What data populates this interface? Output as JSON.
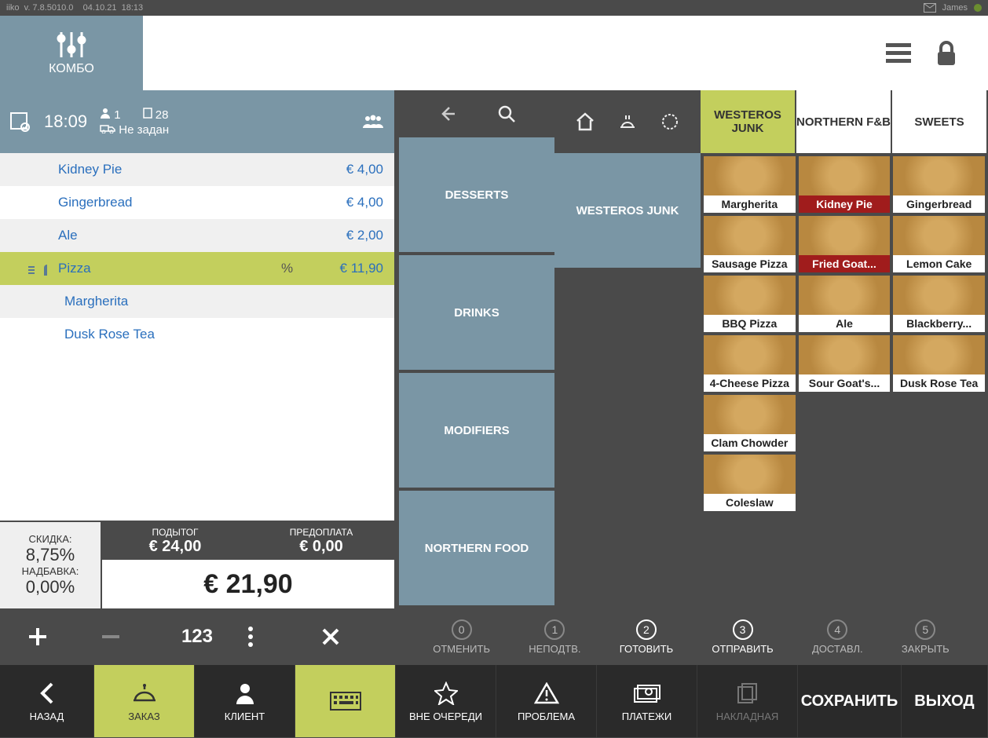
{
  "topbar": {
    "app": "iiko",
    "version": "v. 7.8.5010.0",
    "date": "04.10.21",
    "time": "18:13",
    "user": "James"
  },
  "combo": {
    "label": "КОМБО"
  },
  "order": {
    "time": "18:09",
    "guests": "1",
    "tabs": "28",
    "delivery": "Не задан",
    "items": [
      {
        "name": "Kidney Pie",
        "price": "€ 4,00",
        "icon": "",
        "percent": "",
        "sub": false
      },
      {
        "name": "Gingerbread",
        "price": "€ 4,00",
        "icon": "",
        "percent": "",
        "sub": false
      },
      {
        "name": "Ale",
        "price": "€ 2,00",
        "icon": "",
        "percent": "",
        "sub": false
      },
      {
        "name": "Pizza",
        "price": "€ 11,90",
        "icon": "combo",
        "percent": "%",
        "sub": false
      },
      {
        "name": "Margherita",
        "price": "",
        "icon": "",
        "percent": "",
        "sub": true
      },
      {
        "name": "Dusk Rose Tea",
        "price": "",
        "icon": "",
        "percent": "",
        "sub": true
      }
    ]
  },
  "totals": {
    "discount_lbl": "СКИДКА:",
    "discount": "8,75%",
    "surcharge_lbl": "НАДБАВКА:",
    "surcharge": "0,00%",
    "subtotal_lbl": "ПОДЫТОГ",
    "subtotal": "€ 24,00",
    "prepay_lbl": "ПРЕДОПЛАТА",
    "prepay": "€ 0,00",
    "total": "€ 21,90"
  },
  "numpad": {
    "num": "123"
  },
  "categories": [
    "DESSERTS",
    "DRINKS",
    "MODIFIERS",
    "NORTHERN FOOD"
  ],
  "featured_cat": "WESTEROS JUNK",
  "menu_tabs": [
    "WESTEROS JUNK",
    "NORTHERN F&B",
    "SWEETS"
  ],
  "products": [
    {
      "name": "Margherita",
      "red": false
    },
    {
      "name": "Kidney Pie",
      "red": true
    },
    {
      "name": "Gingerbread",
      "red": false
    },
    {
      "name": "Sausage Pizza",
      "red": false
    },
    {
      "name": "Fried Goat...",
      "red": true
    },
    {
      "name": "Lemon Cake",
      "red": false
    },
    {
      "name": "BBQ Pizza",
      "red": false
    },
    {
      "name": "Ale",
      "red": false
    },
    {
      "name": "Blackberry...",
      "red": false
    },
    {
      "name": "4-Cheese Pizza",
      "red": false
    },
    {
      "name": "Sour Goat's...",
      "red": false
    },
    {
      "name": "Dusk Rose Tea",
      "red": false
    },
    {
      "name": "Clam Chowder",
      "red": false
    },
    {
      "name": "Coleslaw",
      "red": false
    }
  ],
  "steps": [
    {
      "num": "0",
      "label": "ОТМЕНИТЬ",
      "active": false
    },
    {
      "num": "1",
      "label": "НЕПОДТВ.",
      "active": false
    },
    {
      "num": "2",
      "label": "ГОТОВИТЬ",
      "active": true
    },
    {
      "num": "3",
      "label": "ОТПРАВИТЬ",
      "active": true
    },
    {
      "num": "4",
      "label": "ДОСТАВЛ.",
      "active": false
    },
    {
      "num": "5",
      "label": "ЗАКРЫТЬ",
      "active": false
    }
  ],
  "bottom": {
    "back": "НАЗАД",
    "order": "ЗАКАЗ",
    "client": "КЛИЕНТ",
    "priority": "ВНЕ ОЧЕРЕДИ",
    "problem": "ПРОБЛЕМА",
    "payments": "ПЛАТЕЖИ",
    "invoice": "НАКЛАДНАЯ",
    "save": "СОХРАНИТЬ",
    "exit": "ВЫХОД"
  }
}
